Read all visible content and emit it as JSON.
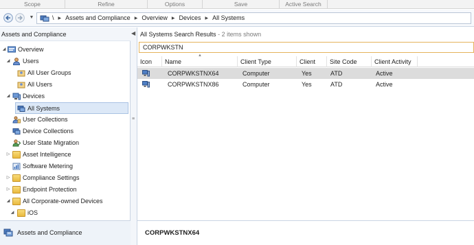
{
  "ribbon": {
    "groups": [
      "Scope",
      "Refine",
      "Options",
      "Save",
      "Active Search"
    ]
  },
  "nav": {
    "back_icon": "arrow-left-icon",
    "forward_icon": "arrow-right-icon",
    "breadcrumbs": [
      "\\",
      "Assets and Compliance",
      "Overview",
      "Devices",
      "All Systems"
    ]
  },
  "left_pane": {
    "header": "Assets and Compliance",
    "tree": [
      {
        "label": "Overview",
        "icon": "overview-icon"
      },
      {
        "label": "Users",
        "icon": "user-icon"
      },
      {
        "label": "All User Groups",
        "icon": "user-collection-icon"
      },
      {
        "label": "All Users",
        "icon": "user-collection-icon"
      },
      {
        "label": "Devices",
        "icon": "devices-icon"
      },
      {
        "label": "All Systems",
        "icon": "device-collection-icon"
      },
      {
        "label": "User Collections",
        "icon": "user-collections-icon"
      },
      {
        "label": "Device Collections",
        "icon": "device-collections-icon"
      },
      {
        "label": "User State Migration",
        "icon": "user-state-migration-icon"
      },
      {
        "label": "Asset Intelligence",
        "icon": "folder-icon"
      },
      {
        "label": "Software Metering",
        "icon": "software-metering-icon"
      },
      {
        "label": "Compliance Settings",
        "icon": "folder-icon"
      },
      {
        "label": "Endpoint Protection",
        "icon": "folder-icon"
      },
      {
        "label": "All Corporate-owned Devices",
        "icon": "folder-icon"
      },
      {
        "label": "iOS",
        "icon": "folder-icon"
      }
    ],
    "workspace": "Assets and Compliance"
  },
  "results": {
    "title": "All Systems Search Results",
    "count": "2 items shown",
    "search_value": "CORPWKSTN",
    "columns": [
      "Icon",
      "Name",
      "Client Type",
      "Client",
      "Site Code",
      "Client Activity"
    ],
    "rows": [
      {
        "name": "CORPWKSTNX64",
        "client_type": "Computer",
        "client": "Yes",
        "site_code": "ATD",
        "activity": "Active",
        "icon": "computer-icon"
      },
      {
        "name": "CORPWKSTNX86",
        "client_type": "Computer",
        "client": "Yes",
        "site_code": "ATD",
        "activity": "Active",
        "icon": "computer-icon"
      }
    ],
    "detail_title": "CORPWKSTNX64"
  },
  "colors": {
    "selection": "#dce8f7",
    "row_selected": "#dcdcdc",
    "search_border": "#e4b35b",
    "folder": "#e9b93f"
  }
}
